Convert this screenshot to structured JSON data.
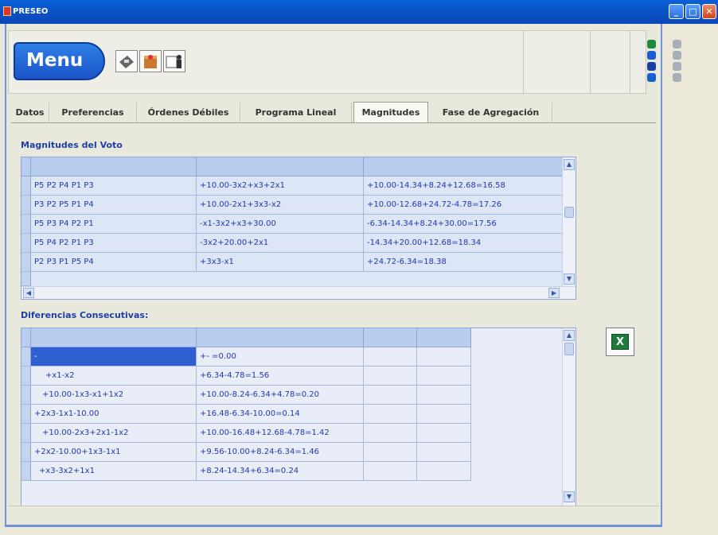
{
  "window": {
    "title": "PRESEO"
  },
  "toolbar": {
    "menu_label": "Menu"
  },
  "tabs": [
    {
      "label": "Datos",
      "active": false
    },
    {
      "label": "Preferencias",
      "active": false
    },
    {
      "label": "Órdenes Débiles",
      "active": false
    },
    {
      "label": "Programa Lineal",
      "active": false
    },
    {
      "label": "Magnitudes",
      "active": true
    },
    {
      "label": "Fase de Agregación",
      "active": false
    }
  ],
  "section1": {
    "title": "Magnitudes del Voto",
    "rows": [
      [
        "P5 P2 P4 P1 P3",
        "+10.00-3x2+x3+2x1",
        "+10.00-14.34+8.24+12.68=16.58"
      ],
      [
        "P3 P2 P5 P1 P4",
        "+10.00-2x1+3x3-x2",
        "+10.00-12.68+24.72-4.78=17.26"
      ],
      [
        "P5 P3 P4 P2 P1",
        "-x1-3x2+x3+30.00",
        "-6.34-14.34+8.24+30.00=17.56"
      ],
      [
        "P5 P4 P2 P1 P3",
        "-3x2+20.00+2x1",
        "-14.34+20.00+12.68=18.34"
      ],
      [
        "P2 P3 P1 P5 P4",
        "+3x3-x1",
        "+24.72-6.34=18.38"
      ]
    ]
  },
  "section2": {
    "title": "Diferencias Consecutivas:",
    "rows": [
      [
        "-",
        "+- =0.00"
      ],
      [
        "+x1-x2",
        "+6.34-4.78=1.56"
      ],
      [
        "+10.00-1x3-x1+1x2",
        "+10.00-8.24-6.34+4.78=0.20"
      ],
      [
        "+2x3-1x1-10.00",
        "+16.48-6.34-10.00=0.14"
      ],
      [
        "+10.00-2x3+2x1-1x2",
        "+10.00-16.48+12.68-4.78=1.42"
      ],
      [
        "+2x2-10.00+1x3-1x1",
        "+9.56-10.00+8.24-6.34=1.46"
      ],
      [
        "+x3-3x2+1x1",
        "+8.24-14.34+6.34=0.24"
      ]
    ]
  },
  "colors": {
    "title_bar": "#0b4fc0",
    "grid_text": "#2437b3",
    "section_title": "#1f3fa5",
    "selected_cell": "#2f5fd0"
  }
}
